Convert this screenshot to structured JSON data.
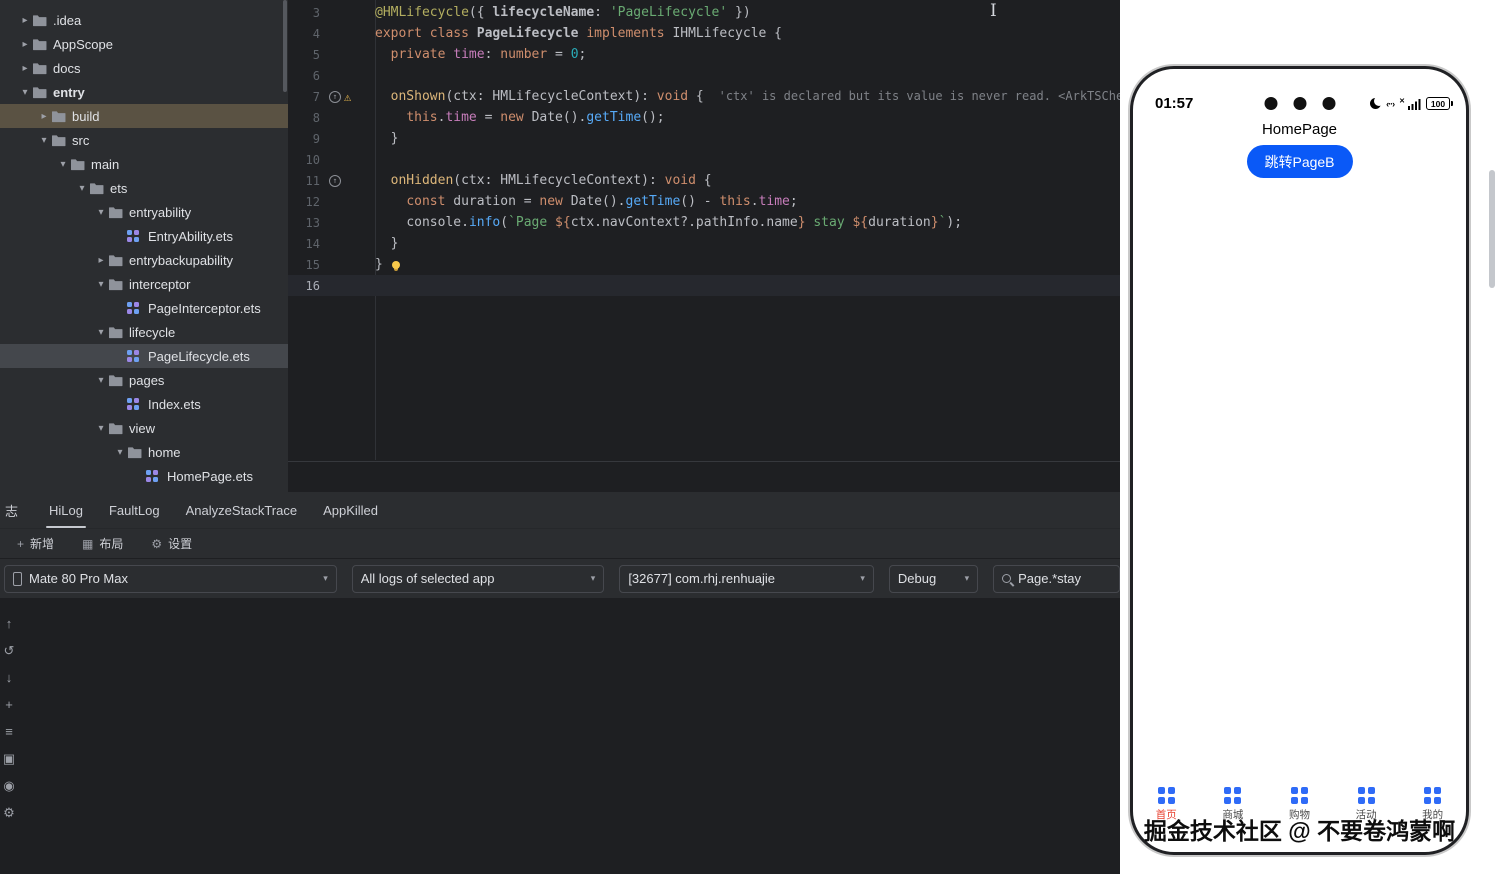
{
  "project_tree": {
    "items": [
      {
        "label": ".idea",
        "level": 0,
        "type": "folder",
        "state": "collapsed"
      },
      {
        "label": "AppScope",
        "level": 0,
        "type": "folder",
        "state": "collapsed"
      },
      {
        "label": "docs",
        "level": 0,
        "type": "folder",
        "state": "collapsed"
      },
      {
        "label": "entry",
        "level": 0,
        "type": "module",
        "state": "expanded"
      },
      {
        "label": "build",
        "level": 1,
        "type": "folder",
        "state": "collapsed",
        "highlight": true
      },
      {
        "label": "src",
        "level": 1,
        "type": "folder",
        "state": "expanded"
      },
      {
        "label": "main",
        "level": 2,
        "type": "folder",
        "state": "expanded"
      },
      {
        "label": "ets",
        "level": 3,
        "type": "folder",
        "state": "expanded"
      },
      {
        "label": "entryability",
        "level": 4,
        "type": "folder",
        "state": "expanded"
      },
      {
        "label": "EntryAbility.ets",
        "level": 5,
        "type": "file"
      },
      {
        "label": "entrybackupability",
        "level": 4,
        "type": "folder",
        "state": "collapsed"
      },
      {
        "label": "interceptor",
        "level": 4,
        "type": "folder",
        "state": "expanded"
      },
      {
        "label": "PageInterceptor.ets",
        "level": 5,
        "type": "file"
      },
      {
        "label": "lifecycle",
        "level": 4,
        "type": "folder",
        "state": "expanded"
      },
      {
        "label": "PageLifecycle.ets",
        "level": 5,
        "type": "file",
        "selected": true
      },
      {
        "label": "pages",
        "level": 4,
        "type": "folder",
        "state": "expanded"
      },
      {
        "label": "Index.ets",
        "level": 5,
        "type": "file"
      },
      {
        "label": "view",
        "level": 4,
        "type": "folder",
        "state": "expanded"
      },
      {
        "label": "home",
        "level": 5,
        "type": "folder",
        "state": "expanded"
      },
      {
        "label": "HomePage.ets",
        "level": 6,
        "type": "file"
      }
    ]
  },
  "editor": {
    "lines": [
      {
        "n": 3,
        "seg": [
          [
            "@HMLifecycle",
            "ann"
          ],
          [
            "({ ",
            "p"
          ],
          [
            "lifecycleName",
            "prop"
          ],
          [
            ": ",
            "p"
          ],
          [
            "'PageLifecycle'",
            "str"
          ],
          [
            " })",
            "p"
          ]
        ]
      },
      {
        "n": 4,
        "seg": [
          [
            "export ",
            "kw"
          ],
          [
            "class ",
            "kw"
          ],
          [
            "PageLifecycle",
            "cls-decl"
          ],
          [
            " implements ",
            "kw"
          ],
          [
            "IHMLifecycle",
            "type"
          ],
          [
            " {",
            "p"
          ]
        ]
      },
      {
        "n": 5,
        "seg": [
          [
            "  ",
            "p"
          ],
          [
            "private ",
            "kw"
          ],
          [
            "time",
            "field"
          ],
          [
            ": ",
            "p"
          ],
          [
            "number",
            "kw"
          ],
          [
            " = ",
            "p"
          ],
          [
            "0",
            "num"
          ],
          [
            ";",
            "p"
          ]
        ]
      },
      {
        "n": 6,
        "seg": []
      },
      {
        "n": 7,
        "gutter": [
          "override",
          "warning"
        ],
        "seg": [
          [
            "  ",
            "p"
          ],
          [
            "onShown",
            "fn-decl"
          ],
          [
            "(",
            "p"
          ],
          [
            "ctx",
            "param"
          ],
          [
            ": ",
            "p"
          ],
          [
            "HMLifecycleContext",
            "type"
          ],
          [
            "): ",
            "p"
          ],
          [
            "void",
            "kw"
          ],
          [
            " { ",
            "p"
          ],
          [
            "'ctx' is declared but its value is never read. <ArkTSCheck>",
            "hint"
          ]
        ]
      },
      {
        "n": 8,
        "seg": [
          [
            "    ",
            "p"
          ],
          [
            "this",
            "kw"
          ],
          [
            ".",
            "p"
          ],
          [
            "time",
            "field"
          ],
          [
            " = ",
            "p"
          ],
          [
            "new ",
            "kw"
          ],
          [
            "Date",
            "type"
          ],
          [
            "().",
            "p"
          ],
          [
            "getTime",
            "fn-call"
          ],
          [
            "();",
            "p"
          ]
        ]
      },
      {
        "n": 9,
        "seg": [
          [
            "  ",
            "p"
          ],
          [
            "}",
            "p"
          ]
        ]
      },
      {
        "n": 10,
        "seg": []
      },
      {
        "n": 11,
        "gutter": [
          "override"
        ],
        "seg": [
          [
            "  ",
            "p"
          ],
          [
            "onHidden",
            "fn-decl"
          ],
          [
            "(",
            "p"
          ],
          [
            "ctx",
            "param"
          ],
          [
            ": ",
            "p"
          ],
          [
            "HMLifecycleContext",
            "type"
          ],
          [
            "): ",
            "p"
          ],
          [
            "void",
            "kw"
          ],
          [
            " {",
            "p"
          ]
        ]
      },
      {
        "n": 12,
        "seg": [
          [
            "    ",
            "p"
          ],
          [
            "const ",
            "kw"
          ],
          [
            "duration",
            "var"
          ],
          [
            " = ",
            "p"
          ],
          [
            "new ",
            "kw"
          ],
          [
            "Date",
            "type"
          ],
          [
            "().",
            "p"
          ],
          [
            "getTime",
            "fn-call"
          ],
          [
            "() - ",
            "p"
          ],
          [
            "this",
            "kw"
          ],
          [
            ".",
            "p"
          ],
          [
            "time",
            "field"
          ],
          [
            ";",
            "p"
          ]
        ]
      },
      {
        "n": 13,
        "seg": [
          [
            "    ",
            "p"
          ],
          [
            "console",
            "type"
          ],
          [
            ".",
            "p"
          ],
          [
            "info",
            "fn-call"
          ],
          [
            "(",
            "p"
          ],
          [
            "`Page ",
            "str"
          ],
          [
            "${",
            "interp"
          ],
          [
            "ctx.navContext?.pathInfo.name",
            "p"
          ],
          [
            "}",
            "interp"
          ],
          [
            " stay ",
            "str"
          ],
          [
            "${",
            "interp"
          ],
          [
            "duration",
            "p"
          ],
          [
            "}",
            "interp"
          ],
          [
            "`",
            "str"
          ],
          [
            ");",
            "p"
          ]
        ]
      },
      {
        "n": 14,
        "seg": [
          [
            "  ",
            "p"
          ],
          [
            "}",
            "p"
          ]
        ]
      },
      {
        "n": 15,
        "seg": [
          [
            "}",
            "p"
          ],
          [
            "",
            "bulb"
          ]
        ]
      },
      {
        "n": 16,
        "current": true,
        "seg": []
      }
    ]
  },
  "log_panel": {
    "title": "志",
    "tabs": [
      {
        "label": "HiLog",
        "active": true
      },
      {
        "label": "FaultLog"
      },
      {
        "label": "AnalyzeStackTrace"
      },
      {
        "label": "AppKilled"
      }
    ],
    "actions": [
      {
        "label": "新增",
        "icon": "+"
      },
      {
        "label": "布局",
        "icon": "▦"
      },
      {
        "label": "设置",
        "icon": "⚙"
      }
    ],
    "filters": {
      "device": "Mate 80 Pro Max",
      "log_scope": "All logs of selected app",
      "process": "[32677] com.rhj.renhuajie",
      "level": "Debug",
      "search": "Page.*stay"
    },
    "side_icons": [
      {
        "name": "scroll-up-icon",
        "glyph": "↑"
      },
      {
        "name": "restart-icon",
        "glyph": "↺"
      },
      {
        "name": "scroll-to-end-icon",
        "glyph": "↓"
      },
      {
        "name": "add-icon",
        "glyph": "+"
      },
      {
        "name": "soft-wrap-icon",
        "glyph": "≡"
      },
      {
        "name": "clear-log-icon",
        "glyph": "▣"
      },
      {
        "name": "record-icon",
        "glyph": "◉"
      },
      {
        "name": "settings-icon",
        "glyph": "⚙"
      }
    ]
  },
  "phone": {
    "time": "01:57",
    "sync_glyph": "‹··›",
    "no_sim_glyph": "✕",
    "battery": "100",
    "page_title": "HomePage",
    "button": "跳转PageB",
    "nav": [
      {
        "label": "首页",
        "color": "#e8402f"
      },
      {
        "label": "商城",
        "color": "#4c4c4c"
      },
      {
        "label": "购物",
        "color": "#4c4c4c"
      },
      {
        "label": "活动",
        "color": "#4c4c4c"
      },
      {
        "label": "我的",
        "color": "#4c4c4c"
      }
    ],
    "watermark": "掘金技术社区 @ 不要卷鸿蒙啊",
    "accent": "#0a59f7"
  }
}
